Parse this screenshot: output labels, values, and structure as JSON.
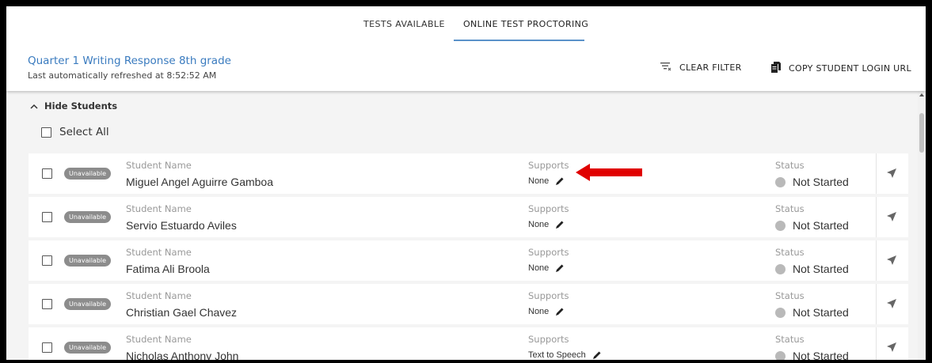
{
  "tabs": [
    {
      "label": "TESTS AVAILABLE",
      "active": false
    },
    {
      "label": "ONLINE TEST PROCTORING",
      "active": true
    }
  ],
  "header": {
    "test_title": "Quarter 1 Writing Response 8th grade",
    "refresh_text": "Last automatically refreshed at 8:52:52 AM",
    "clear_filter_label": "CLEAR FILTER",
    "copy_url_label": "COPY STUDENT LOGIN URL"
  },
  "list": {
    "hide_students_label": "Hide Students",
    "select_all_label": "Select All",
    "col_name_label": "Student Name",
    "col_supports_label": "Supports",
    "col_status_label": "Status",
    "students": [
      {
        "badge": "Unavailable",
        "name": "Miguel Angel Aguirre Gamboa",
        "supports": "None",
        "status": "Not Started"
      },
      {
        "badge": "Unavailable",
        "name": "Servio Estuardo Aviles",
        "supports": "None",
        "status": "Not Started"
      },
      {
        "badge": "Unavailable",
        "name": "Fatima Ali Broola",
        "supports": "None",
        "status": "Not Started"
      },
      {
        "badge": "Unavailable",
        "name": "Christian Gael Chavez",
        "supports": "None",
        "status": "Not Started"
      },
      {
        "badge": "Unavailable",
        "name": "Nicholas Anthony John",
        "supports": "Text to Speech",
        "status": "Not Started"
      }
    ]
  },
  "colors": {
    "accent": "#3a7bbf",
    "tab_underline": "#5a92c9",
    "badge_bg": "#8c8c8c",
    "status_dot": "#b9b9b9",
    "annotation_arrow": "#e00000"
  },
  "icons": {
    "clear_filter": "filter-clear-icon",
    "copy_url": "copy-document-icon",
    "hide_students": "chevron-up-icon",
    "edit_supports": "pencil-icon",
    "send": "send-arrow-icon",
    "annotation": "red-arrow-left-icon"
  }
}
